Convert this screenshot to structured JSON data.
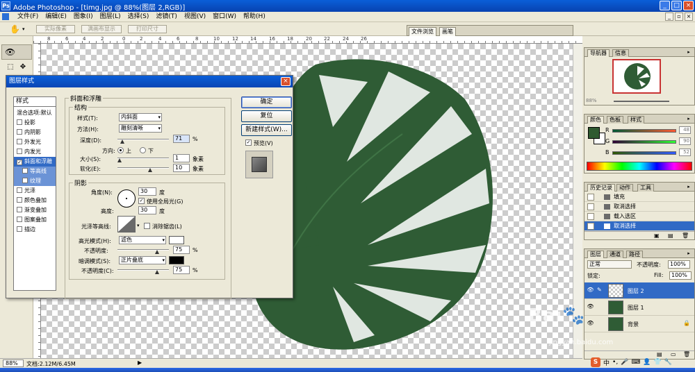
{
  "titlebar": {
    "title": "Adobe Photoshop - [timg.jpg @ 88%(图层 2,RGB)]",
    "min": "_",
    "max": "□",
    "close": "×"
  },
  "menu": [
    "文件(F)",
    "编辑(E)",
    "图象(I)",
    "图层(L)",
    "选择(S)",
    "滤镜(T)",
    "视图(V)",
    "窗口(W)",
    "帮助(H)"
  ],
  "options": {
    "actual_pixels": "实际像素",
    "fit_on_screen": "满画布显示",
    "print_size": "打印尺寸",
    "tab_file_browser": "文件浏览",
    "tab_brushes": "画笔"
  },
  "ruler": {
    "labels": [
      "8",
      "6",
      "4",
      "2",
      "0",
      "2",
      "4",
      "6",
      "8",
      "10",
      "12",
      "14",
      "16",
      "18",
      "20",
      "22",
      "24",
      "26"
    ]
  },
  "statusbar": {
    "zoom": "88%",
    "doc": "文档:2.12M/6.45M"
  },
  "navigator": {
    "tab1": "导航器",
    "tab2": "信息",
    "zoom": "88%"
  },
  "color": {
    "tab1": "颜色",
    "tab2": "色板",
    "tab3": "样式",
    "r_label": "R",
    "g_label": "G",
    "b_label": "B",
    "r": "48",
    "g": "90",
    "b": "52",
    "fg_hex": "#305a34"
  },
  "history": {
    "tab1": "历史记录",
    "tab2": "动作",
    "tab3": "工具",
    "items": [
      {
        "label": "填充"
      },
      {
        "label": "取消选择"
      },
      {
        "label": "载入选区"
      },
      {
        "label": "取消选择"
      }
    ]
  },
  "layers": {
    "tab1": "图层",
    "tab2": "通道",
    "tab3": "路径",
    "blend": "正常",
    "opacity_label": "不透明度:",
    "opacity": "100%",
    "lock_label": "锁定:",
    "fill_label": "Fill:",
    "fill": "100%",
    "items": [
      {
        "name": "图层 2"
      },
      {
        "name": "图层 1"
      },
      {
        "name": "背景"
      }
    ]
  },
  "dialog": {
    "title": "图层样式",
    "styles_header": "样式",
    "style_items": [
      "混合选项:默认",
      "投影",
      "内阴影",
      "外发光",
      "内发光",
      "斜面和浮雕",
      "等高线",
      "纹理",
      "光泽",
      "颜色叠加",
      "渐变叠加",
      "图案叠加",
      "描边"
    ],
    "group_bevel": "斜面和浮雕",
    "group_structure": "结构",
    "style_label": "样式(T):",
    "style_value": "内斜面",
    "technique_label": "方法(H):",
    "technique_value": "雕刻清晰",
    "depth_label": "深度(D):",
    "depth_value": "71",
    "depth_unit": "%",
    "direction_label": "方向:",
    "dir_up": "上",
    "dir_down": "下",
    "size_label": "大小(S):",
    "size_value": "1",
    "size_unit": "象素",
    "soften_label": "软化(E):",
    "soften_value": "10",
    "soften_unit": "象素",
    "group_shading": "阴影",
    "angle_label": "角度(N):",
    "angle_value": "30",
    "angle_unit": "度",
    "global_light": "使用全局光(G)",
    "altitude_label": "高度:",
    "altitude_value": "30",
    "altitude_unit": "度",
    "gloss_label": "光泽等高线:",
    "antialiased": "消除锯齿(L)",
    "highlight_label": "高光模式(H):",
    "highlight_value": "滤色",
    "h_opacity_label": "不透明度:",
    "h_opacity_value": "75",
    "h_opacity_unit": "%",
    "shadow_label": "暗调模式(S):",
    "shadow_value": "正片叠底",
    "s_opacity_label": "不透明度(C):",
    "s_opacity_value": "75",
    "s_opacity_unit": "%",
    "ok": "确定",
    "reset": "复位",
    "new_style": "新建样式(W)...",
    "preview": "预览(V)"
  },
  "watermark": {
    "brand": "Bai",
    "sub": "jingyan.baidu.com"
  },
  "ime": {
    "s": "S",
    "mode": "中"
  }
}
